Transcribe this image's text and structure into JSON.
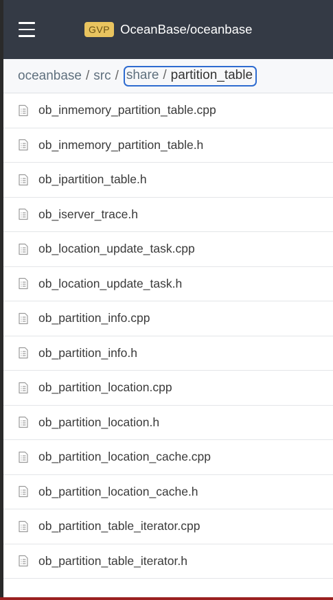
{
  "header": {
    "menu_icon": "hamburger-menu-icon",
    "badge": "GVP",
    "repo_name": "OceanBase/oceanbase"
  },
  "breadcrumb": {
    "items": [
      "oceanbase",
      "src",
      "share",
      "partition_table"
    ],
    "separator": "/"
  },
  "files": [
    {
      "name": "ob_inmemory_partition_table.cpp",
      "icon": "file-icon"
    },
    {
      "name": "ob_inmemory_partition_table.h",
      "icon": "file-icon"
    },
    {
      "name": "ob_ipartition_table.h",
      "icon": "file-icon"
    },
    {
      "name": "ob_iserver_trace.h",
      "icon": "file-icon"
    },
    {
      "name": "ob_location_update_task.cpp",
      "icon": "file-icon"
    },
    {
      "name": "ob_location_update_task.h",
      "icon": "file-icon"
    },
    {
      "name": "ob_partition_info.cpp",
      "icon": "file-icon"
    },
    {
      "name": "ob_partition_info.h",
      "icon": "file-icon"
    },
    {
      "name": "ob_partition_location.cpp",
      "icon": "file-icon"
    },
    {
      "name": "ob_partition_location.h",
      "icon": "file-icon"
    },
    {
      "name": "ob_partition_location_cache.cpp",
      "icon": "file-icon"
    },
    {
      "name": "ob_partition_location_cache.h",
      "icon": "file-icon"
    },
    {
      "name": "ob_partition_table_iterator.cpp",
      "icon": "file-icon"
    },
    {
      "name": "ob_partition_table_iterator.h",
      "icon": "file-icon"
    }
  ],
  "colors": {
    "header_bg": "#343a45",
    "badge_bg": "#e9c45f",
    "highlight_border": "#2d6bd0",
    "bottom_accent": "#9a2121"
  }
}
